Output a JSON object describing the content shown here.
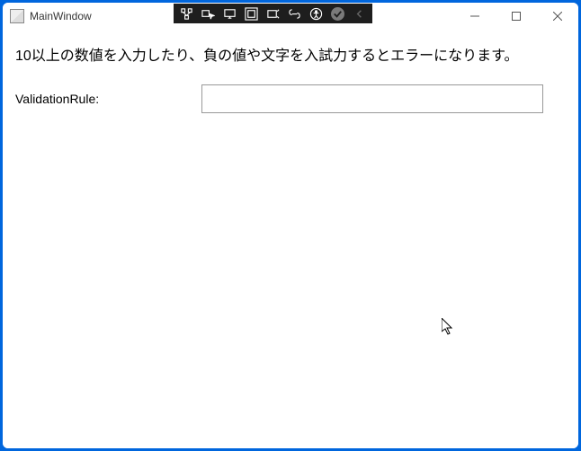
{
  "window": {
    "title": "MainWindow"
  },
  "content": {
    "instruction": "10以上の数値を入力したり、負の値や文字を入試力するとエラーになります。",
    "label": "ValidationRule:",
    "input_value": ""
  }
}
